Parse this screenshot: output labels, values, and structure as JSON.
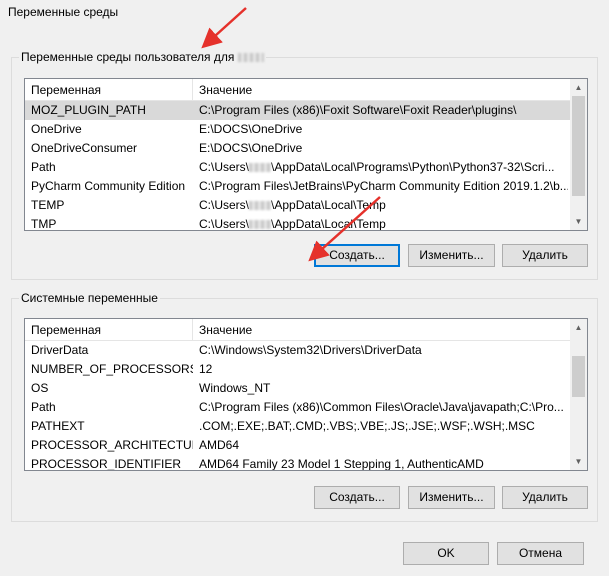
{
  "window": {
    "title": "Переменные среды"
  },
  "user_group": {
    "label": "Переменные среды пользователя для",
    "columns": [
      "Переменная",
      "Значение"
    ],
    "rows": [
      {
        "name": "MOZ_PLUGIN_PATH",
        "value": "C:\\Program Files (x86)\\Foxit Software\\Foxit Reader\\plugins\\",
        "selected": true
      },
      {
        "name": "OneDrive",
        "value": "E:\\DOCS\\OneDrive"
      },
      {
        "name": "OneDriveConsumer",
        "value": "E:\\DOCS\\OneDrive"
      },
      {
        "name": "Path",
        "value_prefix": "C:\\Users\\",
        "value_suffix": "\\AppData\\Local\\Programs\\Python\\Python37-32\\Scri..."
      },
      {
        "name": "PyCharm Community Edition",
        "value": "C:\\Program Files\\JetBrains\\PyCharm Community Edition 2019.1.2\\b..."
      },
      {
        "name": "TEMP",
        "value_prefix": "C:\\Users\\",
        "value_suffix": "\\AppData\\Local\\Temp"
      },
      {
        "name": "TMP",
        "value_prefix": "C:\\Users\\",
        "value_suffix": "\\AppData\\Local\\Temp"
      }
    ],
    "buttons": {
      "new": "Создать...",
      "edit": "Изменить...",
      "delete": "Удалить"
    },
    "scroll": {
      "position": 0,
      "visible_fraction": 0.75
    }
  },
  "system_group": {
    "label": "Системные переменные",
    "columns": [
      "Переменная",
      "Значение"
    ],
    "rows": [
      {
        "name": "DriverData",
        "value": "C:\\Windows\\System32\\Drivers\\DriverData"
      },
      {
        "name": "NUMBER_OF_PROCESSORS",
        "value": "12"
      },
      {
        "name": "OS",
        "value": "Windows_NT"
      },
      {
        "name": "Path",
        "value": "C:\\Program Files (x86)\\Common Files\\Oracle\\Java\\javapath;C:\\Pro..."
      },
      {
        "name": "PATHEXT",
        "value": ".COM;.EXE;.BAT;.CMD;.VBS;.VBE;.JS;.JSE;.WSF;.WSH;.MSC"
      },
      {
        "name": "PROCESSOR_ARCHITECTURE",
        "value": "AMD64"
      },
      {
        "name": "PROCESSOR_IDENTIFIER",
        "value": "AMD64 Family 23 Model 1 Stepping 1, AuthenticAMD"
      }
    ],
    "buttons": {
      "new": "Создать...",
      "edit": "Изменить...",
      "delete": "Удалить"
    },
    "scroll": {
      "position": 0,
      "visible_fraction": 0.35
    }
  },
  "footer": {
    "ok": "OK",
    "cancel": "Отмена"
  },
  "colors": {
    "annotation_arrow": "#e5312b",
    "focus_border": "#0078d7",
    "selection": "#d9d9d9"
  },
  "icons": [
    "chevron-up-icon",
    "chevron-down-icon",
    "annotation-arrow"
  ]
}
